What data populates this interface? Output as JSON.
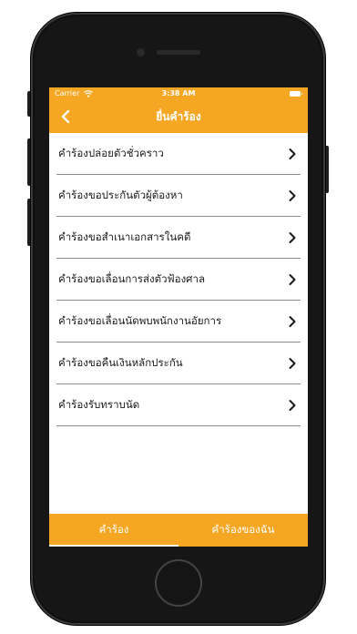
{
  "status_bar": {
    "carrier": "Carrier",
    "time": "3:38 AM"
  },
  "nav": {
    "title": "ยื่นคำร้อง",
    "back_icon": "chevron-left-icon"
  },
  "list": {
    "items": [
      {
        "label": "คำร้องปล่อยตัวชั่วคราว"
      },
      {
        "label": "คำร้องขอประกันตัวผู้ต้องหา"
      },
      {
        "label": "คำร้องขอสำเนาเอกสารในคดี"
      },
      {
        "label": "คำร้องขอเลื่อนการส่งตัวฟ้องศาล"
      },
      {
        "label": "คำร้องขอเลื่อนนัดพบพนักงานอัยการ"
      },
      {
        "label": "คำร้องขอคืนเงินหลักประกัน"
      },
      {
        "label": "คำร้องรับทราบนัด"
      }
    ]
  },
  "tabs": [
    {
      "label": "คำร้อง",
      "active": true
    },
    {
      "label": "คำร้องของฉัน",
      "active": false
    }
  ],
  "colors": {
    "accent": "#f5a623",
    "text": "#1a1a1a",
    "divider": "#8c8c8c"
  }
}
